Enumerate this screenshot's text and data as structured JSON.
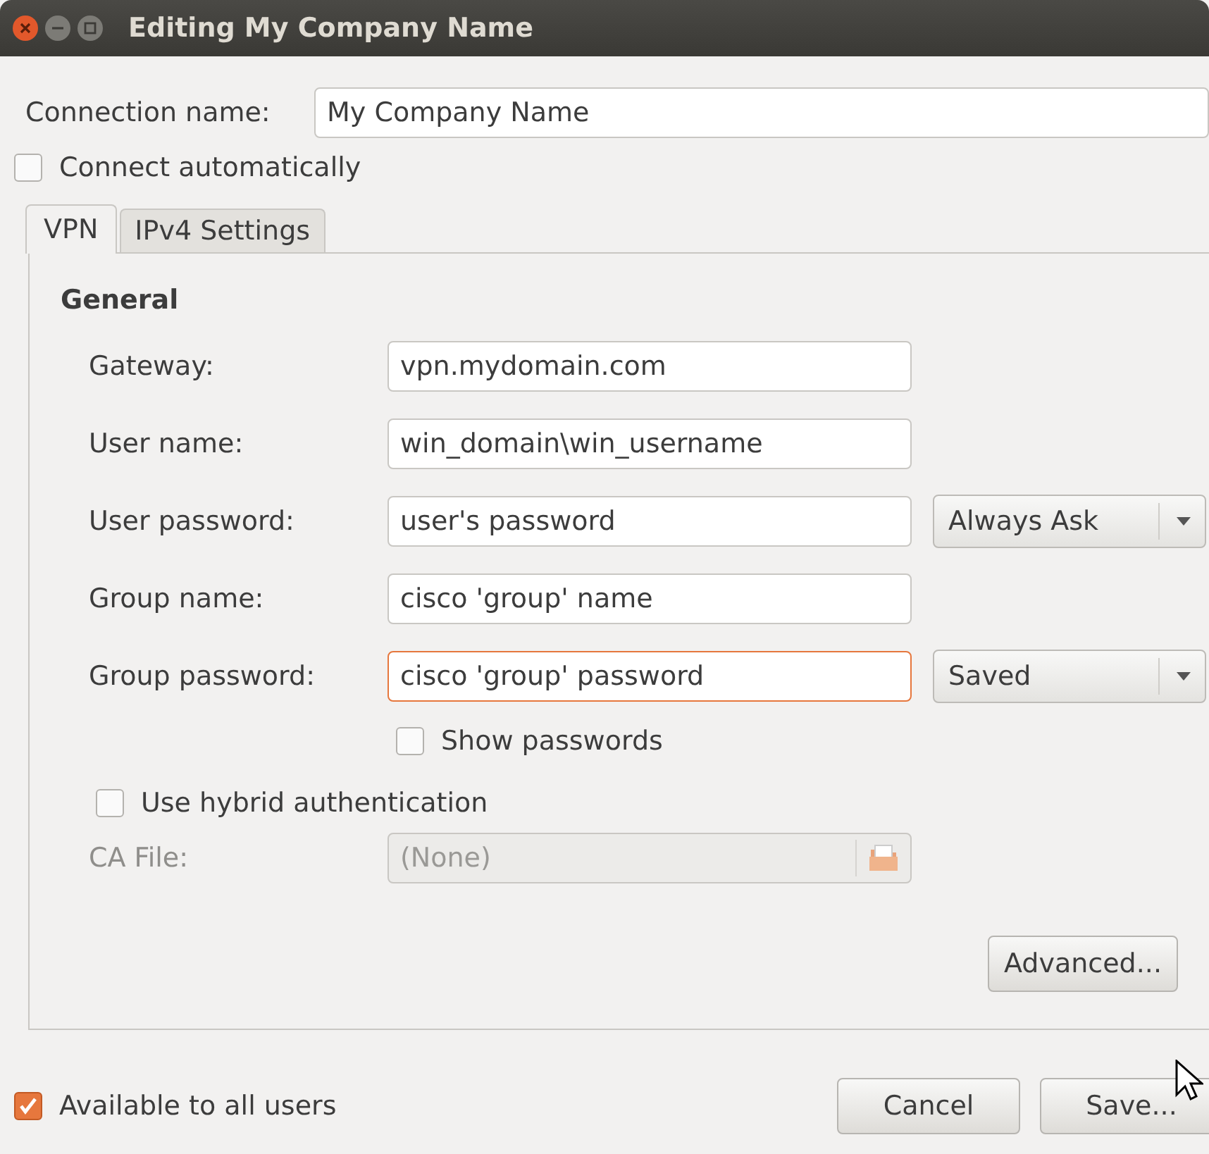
{
  "window": {
    "title": "Editing My Company Name"
  },
  "connection_name": {
    "label": "Connection name:",
    "value": "My Company Name"
  },
  "connect_automatically": {
    "label": "Connect automatically",
    "checked": false
  },
  "tabs": [
    {
      "label": "VPN",
      "selected": true
    },
    {
      "label": "IPv4 Settings",
      "selected": false
    }
  ],
  "section_title": "General",
  "rows": [
    {
      "label": "Gateway:",
      "value": "vpn.mydomain.com",
      "focused": false
    },
    {
      "label": "User name:",
      "value": "win_domain\\win_username",
      "focused": false
    },
    {
      "label": "User password:",
      "value": "user's password",
      "focused": false,
      "dropdown": "Always Ask"
    },
    {
      "label": "Group name:",
      "value": "cisco 'group' name",
      "focused": false
    },
    {
      "label": "Group password:",
      "value": "cisco 'group' password",
      "focused": true,
      "dropdown": "Saved"
    }
  ],
  "show_passwords": {
    "label": "Show passwords",
    "checked": false
  },
  "hybrid": {
    "label": "Use hybrid authentication",
    "checked": false
  },
  "ca_file": {
    "label": "CA File:",
    "value": "(None)",
    "disabled": true
  },
  "advanced_button": "Advanced...",
  "available_to_all": {
    "label": "Available to all users",
    "checked": true
  },
  "buttons": [
    "Cancel",
    "Save..."
  ]
}
